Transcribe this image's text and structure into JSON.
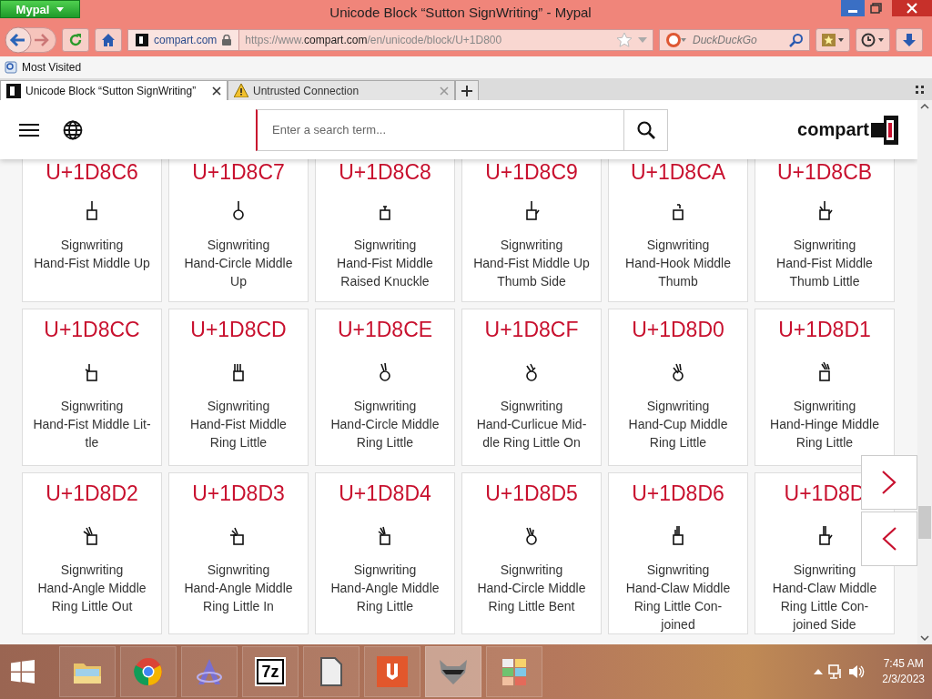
{
  "window": {
    "app_menu": "Mypal",
    "title": "Unicode Block “Sutton SignWriting” - Mypal"
  },
  "toolbar": {
    "site": "compart.com",
    "url_prefix": "https://www.",
    "url_domain": "compart.com",
    "url_path": "/en/unicode/block/U+1D800",
    "search_placeholder": "DuckDuckGo"
  },
  "bookmarks": [
    "Most Visited"
  ],
  "tabs": [
    {
      "label": "Unicode Block “Sutton SignWriting”",
      "selected": true,
      "kind": "site"
    },
    {
      "label": "Untrusted Connection",
      "selected": false,
      "kind": "warning"
    }
  ],
  "page": {
    "search_placeholder": "Enter a search term...",
    "logo": "compart"
  },
  "cards": [
    {
      "code": "U+1D8C6",
      "name": "Signwriting\nHand-Fist Middle Up"
    },
    {
      "code": "U+1D8C7",
      "name": "Signwriting\nHand-Circle Middle\nUp"
    },
    {
      "code": "U+1D8C8",
      "name": "Signwriting\nHand-Fist Middle\nRaised Knuckle"
    },
    {
      "code": "U+1D8C9",
      "name": "Signwriting\nHand-Fist Middle Up\nThumb Side"
    },
    {
      "code": "U+1D8CA",
      "name": "Signwriting\nHand-Hook Middle\nThumb"
    },
    {
      "code": "U+1D8CB",
      "name": "Signwriting\nHand-Fist Middle\nThumb Little"
    },
    {
      "code": "U+1D8CC",
      "name": "Signwriting\nHand-Fist Middle Lit-\ntle"
    },
    {
      "code": "U+1D8CD",
      "name": "Signwriting\nHand-Fist Middle\nRing Little"
    },
    {
      "code": "U+1D8CE",
      "name": "Signwriting\nHand-Circle Middle\nRing Little"
    },
    {
      "code": "U+1D8CF",
      "name": "Signwriting\nHand-Curlicue Mid-\ndle Ring Little On"
    },
    {
      "code": "U+1D8D0",
      "name": "Signwriting\nHand-Cup Middle\nRing Little"
    },
    {
      "code": "U+1D8D1",
      "name": "Signwriting\nHand-Hinge Middle\nRing Little"
    },
    {
      "code": "U+1D8D2",
      "name": "Signwriting\nHand-Angle Middle\nRing Little Out"
    },
    {
      "code": "U+1D8D3",
      "name": "Signwriting\nHand-Angle Middle\nRing Little In"
    },
    {
      "code": "U+1D8D4",
      "name": "Signwriting\nHand-Angle Middle\nRing Little"
    },
    {
      "code": "U+1D8D5",
      "name": "Signwriting\nHand-Circle Middle\nRing Little Bent"
    },
    {
      "code": "U+1D8D6",
      "name": "Signwriting\nHand-Claw Middle\nRing Little Con-\njoined"
    },
    {
      "code": "U+1D8D",
      "name": "Signwriting\nHand-Claw Middle\nRing Little Con-\njoined Side"
    }
  ],
  "taskbar": {
    "apps": [
      {
        "kind": "folder",
        "selected": false
      },
      {
        "kind": "browser",
        "selected": false
      },
      {
        "kind": "font",
        "selected": false
      },
      {
        "kind": "archive",
        "label": "7z",
        "selected": false
      },
      {
        "kind": "document",
        "selected": false
      },
      {
        "kind": "reader",
        "selected": false
      },
      {
        "kind": "raccoon",
        "selected": true
      },
      {
        "kind": "grid",
        "selected": false
      }
    ],
    "time": "7:45 AM",
    "date": "2/3/2023"
  }
}
